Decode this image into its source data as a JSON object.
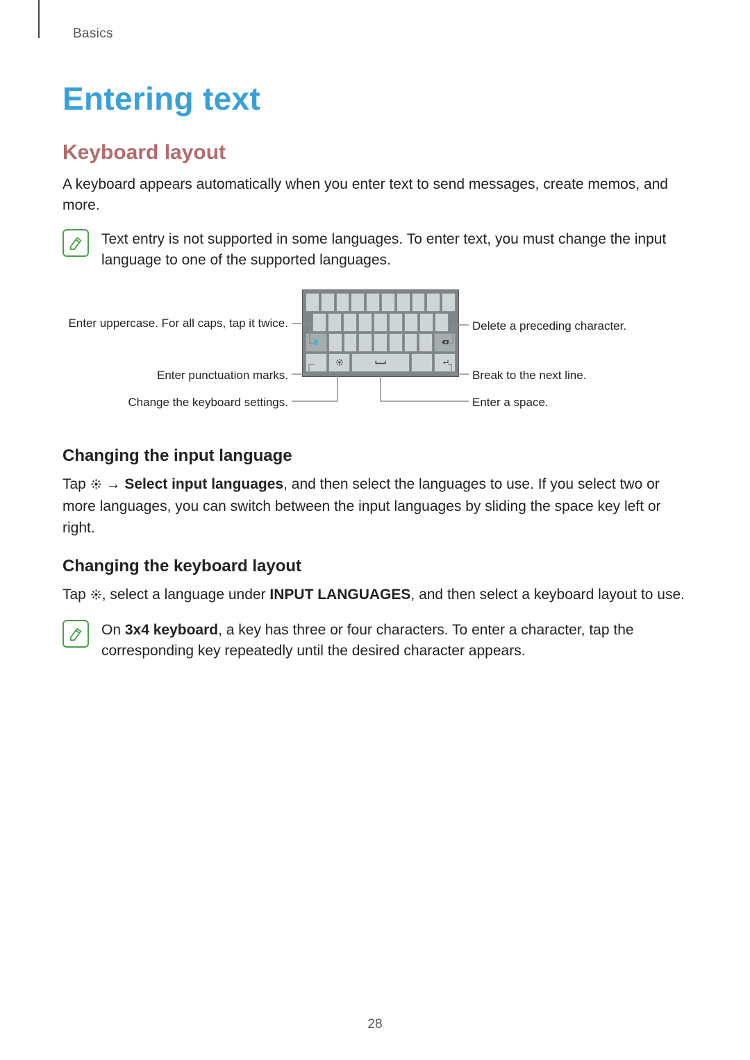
{
  "breadcrumb": "Basics",
  "title": "Entering text",
  "sections": {
    "keyboard_layout": {
      "heading": "Keyboard layout",
      "intro": "A keyboard appears automatically when you enter text to send messages, create memos, and more.",
      "note": "Text entry is not supported in some languages. To enter text, you must change the input language to one of the supported languages."
    },
    "callouts": {
      "uppercase": "Enter uppercase. For all caps, tap it twice.",
      "punctuation": "Enter punctuation marks.",
      "settings": "Change the keyboard settings.",
      "delete": "Delete a preceding character.",
      "nextline": "Break to the next line.",
      "space": "Enter a space."
    },
    "changing_input_language": {
      "heading": "Changing the input language",
      "p1_a": "Tap ",
      "p1_b": " → ",
      "p1_bold": "Select input languages",
      "p1_c": ", and then select the languages to use. If you select two or more languages, you can switch between the input languages by sliding the space key left or right."
    },
    "changing_keyboard_layout": {
      "heading": "Changing the keyboard layout",
      "p1_a": "Tap ",
      "p1_b": ", select a language under ",
      "p1_bold": "INPUT LANGUAGES",
      "p1_c": ", and then select a keyboard layout to use.",
      "note_a": "On ",
      "note_bold": "3x4 keyboard",
      "note_b": ", a key has three or four characters. To enter a character, tap the corresponding key repeatedly until the desired character appears."
    }
  },
  "page_number": "28"
}
